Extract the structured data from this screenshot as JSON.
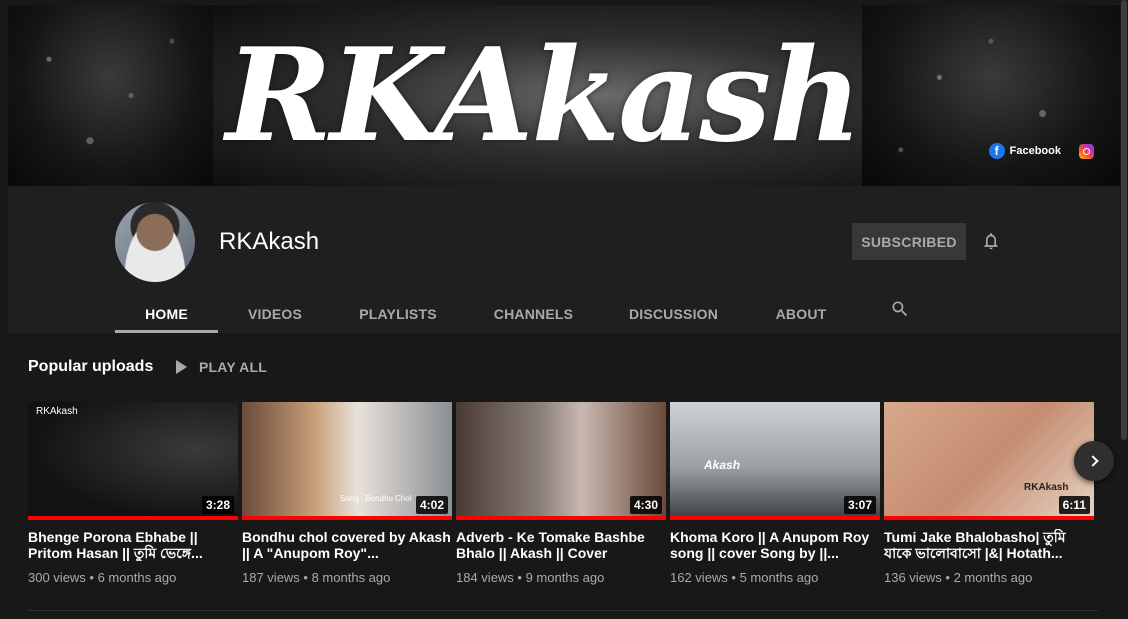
{
  "banner": {
    "logo_text": "RKAkash",
    "links": [
      {
        "label": "Facebook",
        "icon": "facebook-icon"
      },
      {
        "label": "",
        "icon": "instagram-icon"
      }
    ]
  },
  "channel": {
    "name": "RKAkash",
    "subscribe_label": "SUBSCRIBED"
  },
  "tabs": [
    {
      "label": "HOME",
      "active": true
    },
    {
      "label": "VIDEOS"
    },
    {
      "label": "PLAYLISTS"
    },
    {
      "label": "CHANNELS"
    },
    {
      "label": "DISCUSSION"
    },
    {
      "label": "ABOUT"
    }
  ],
  "shelf": {
    "title": "Popular uploads",
    "play_all": "PLAY ALL"
  },
  "videos": [
    {
      "title": "Bhenge Porona Ebhabe || Pritom Hasan || তুমি ভেঙ্গে...",
      "views": "300 views",
      "age": "6 months ago",
      "duration": "3:28",
      "overlay": "RKAkash"
    },
    {
      "title": "Bondhu chol covered by Akash || A \"Anupom Roy\"...",
      "views": "187 views",
      "age": "8 months ago",
      "duration": "4:02",
      "overlay": "Song : Bondhu Chol"
    },
    {
      "title": "Adverb - Ke Tomake Bashbe Bhalo || Akash || Cover",
      "views": "184 views",
      "age": "9 months ago",
      "duration": "4:30",
      "overlay": ""
    },
    {
      "title": "Khoma Koro || A Anupom Roy song || cover Song by ||...",
      "views": "162 views",
      "age": "5 months ago",
      "duration": "3:07",
      "overlay": "Akash"
    },
    {
      "title": "Tumi Jake Bhalobasho| তুমি যাকে ভালোবাসো |&| Hotath...",
      "views": "136 views",
      "age": "2 months ago",
      "duration": "6:11",
      "overlay": "RKAkash"
    }
  ]
}
